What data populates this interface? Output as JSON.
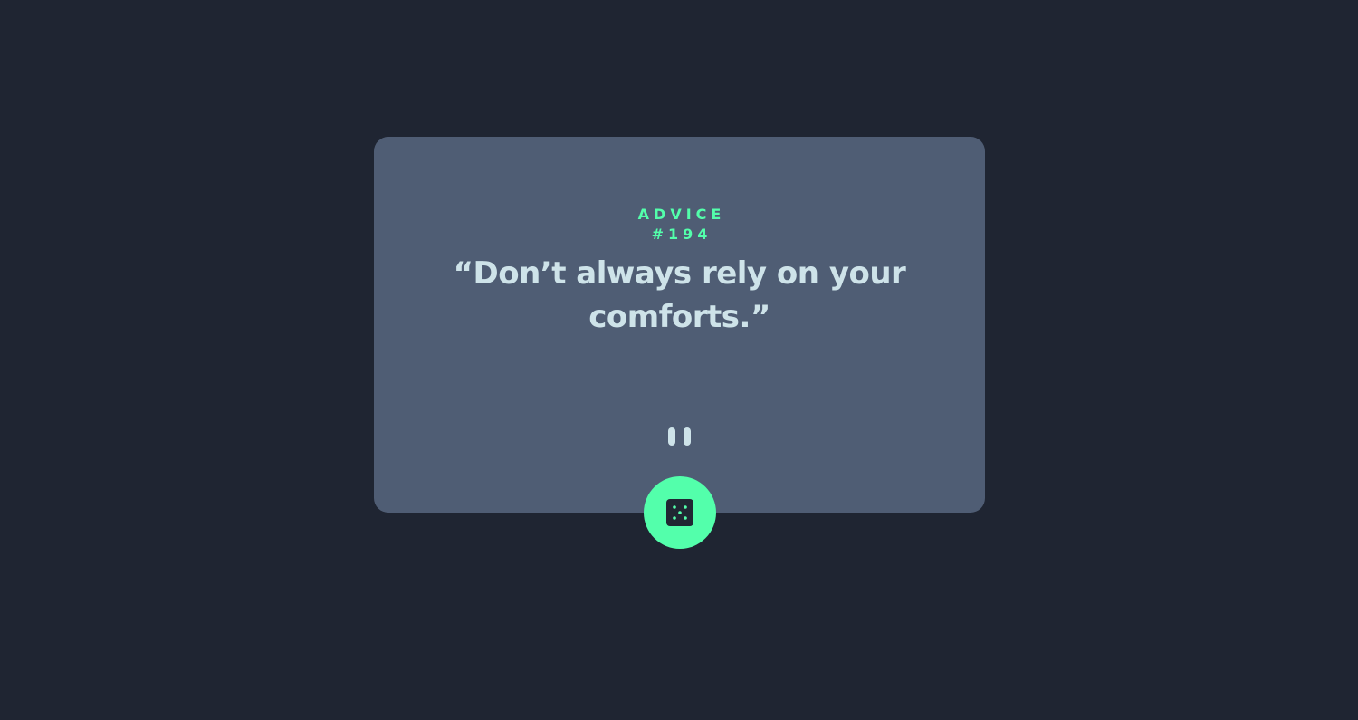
{
  "advice": {
    "label": "ADVICE",
    "number": "#194",
    "quote": "“Don’t always rely on your comforts.”"
  },
  "divider": {
    "icon": "pause-icon"
  },
  "dice_button": {
    "icon": "dice-icon"
  },
  "colors": {
    "background": "#1f2532",
    "card": "#4f5d74",
    "accent": "#53ffab",
    "text": "#cee3e9"
  }
}
